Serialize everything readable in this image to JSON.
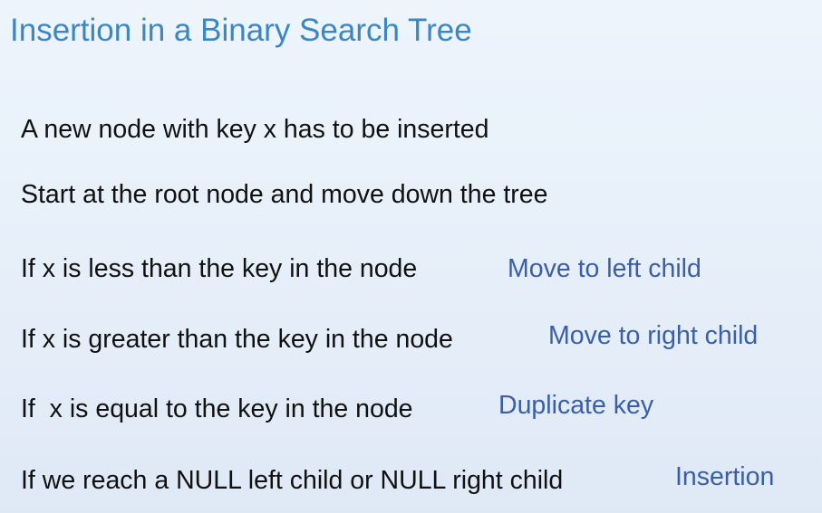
{
  "slide": {
    "title": "Insertion in a Binary Search Tree",
    "statements": [
      "A new node with key x has to be inserted",
      "Start at the root node and move down the tree",
      "If x is less than the key in the node",
      "If x is greater than the key in the node",
      "If  x is equal to the key in the node",
      "If we reach a NULL left child or NULL right child"
    ],
    "results": [
      "Move to left child",
      "Move to right child",
      "Duplicate key",
      "Insertion"
    ]
  },
  "colors": {
    "title": "#3d86c4",
    "text": "#111111",
    "result": "#3b5fa6",
    "background": "#e8f0fa"
  }
}
